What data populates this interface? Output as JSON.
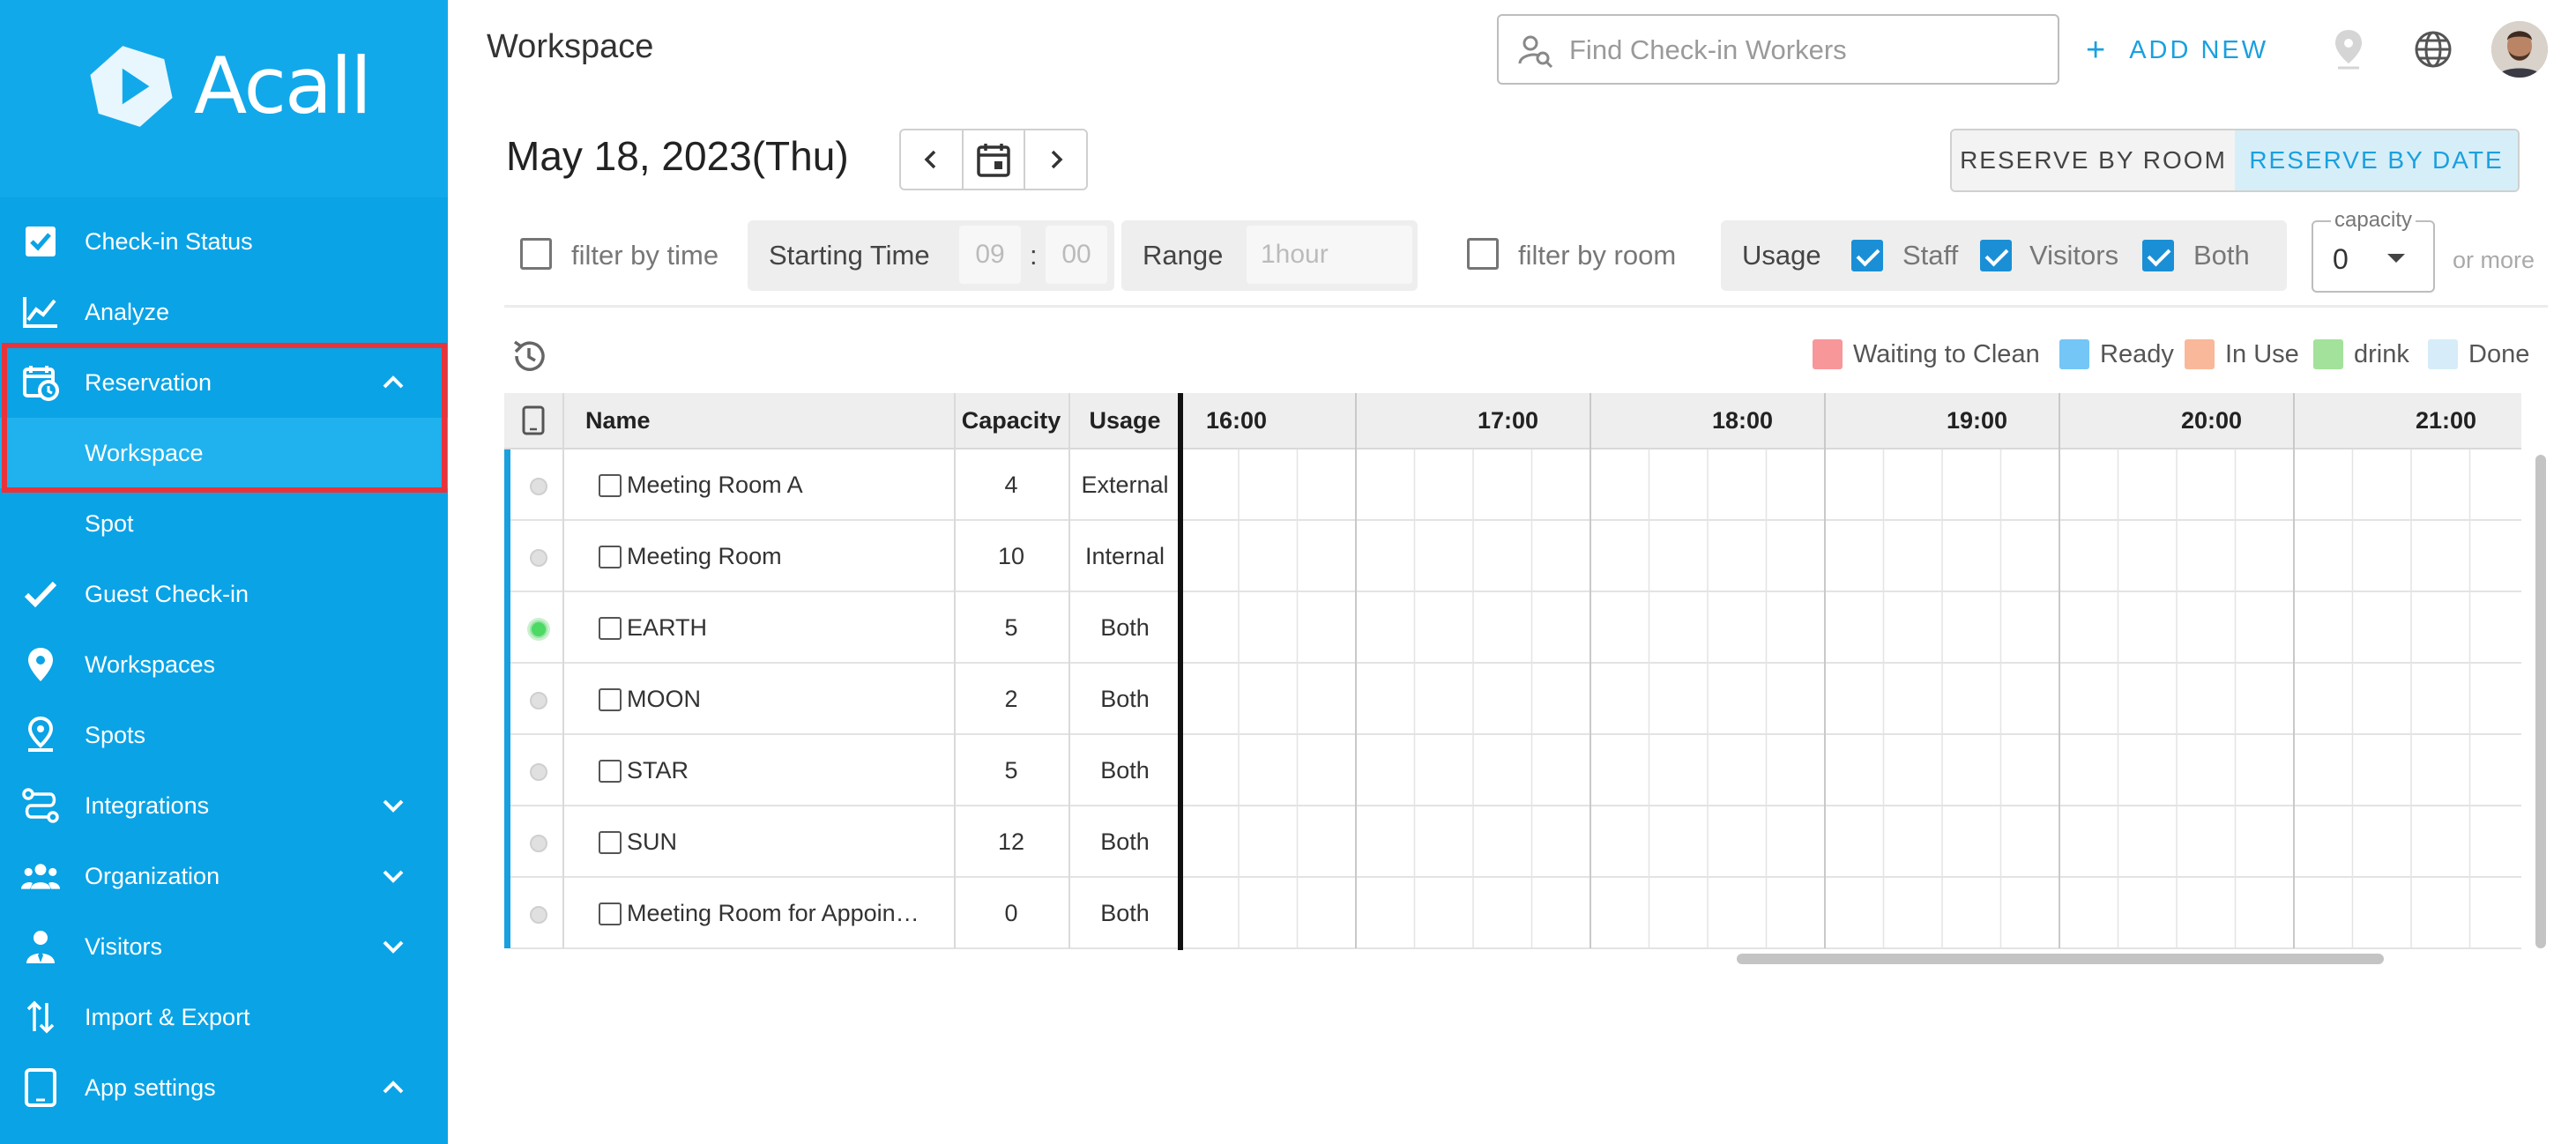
{
  "app": {
    "name": "Acall"
  },
  "sidebar": {
    "items": [
      {
        "label": "Check-in Status",
        "icon": "checkbox-icon"
      },
      {
        "label": "Analyze",
        "icon": "chart-line-icon"
      },
      {
        "label": "Reservation",
        "icon": "calendar-clock-icon",
        "expanded": true
      },
      {
        "label": "Workspace",
        "sub": true,
        "active": true
      },
      {
        "label": "Spot",
        "sub": true
      },
      {
        "label": "Guest Check-in",
        "icon": "check-icon"
      },
      {
        "label": "Workspaces",
        "icon": "map-pin-icon"
      },
      {
        "label": "Spots",
        "icon": "location-pin-icon"
      },
      {
        "label": "Integrations",
        "icon": "integrations-icon",
        "expanded": false
      },
      {
        "label": "Organization",
        "icon": "people-icon",
        "expanded": false
      },
      {
        "label": "Visitors",
        "icon": "visitor-icon",
        "expanded": false
      },
      {
        "label": "Import & Export",
        "icon": "import-export-icon"
      },
      {
        "label": "App settings",
        "icon": "tablet-icon",
        "expanded": true
      }
    ]
  },
  "header": {
    "title": "Workspace",
    "search_placeholder": "Find Check-in Workers",
    "add_new": "ADD NEW"
  },
  "date_bar": {
    "date": "May 18, 2023(Thu)",
    "reserve_by_room": "RESERVE BY ROOM",
    "reserve_by_date": "RESERVE BY DATE",
    "active_mode": "reserve_by_date"
  },
  "filters": {
    "filter_by_time": "filter by time",
    "starting_time_label": "Starting Time",
    "hour": "09",
    "colon": ":",
    "minute": "00",
    "range_label": "Range",
    "range_value": "1hour",
    "filter_by_room": "filter by room",
    "usage_label": "Usage",
    "staff": "Staff",
    "visitors": "Visitors",
    "both": "Both",
    "capacity_label": "capacity",
    "capacity_value": "0",
    "or_more": "or more"
  },
  "legend": [
    {
      "label": "Waiting to Clean",
      "color": "#f7979a"
    },
    {
      "label": "Ready",
      "color": "#74c6f7"
    },
    {
      "label": "In Use",
      "color": "#f9b899"
    },
    {
      "label": "drink",
      "color": "#a3e29a"
    },
    {
      "label": "Done",
      "color": "#d6ecf8"
    }
  ],
  "table": {
    "headers": {
      "name": "Name",
      "capacity": "Capacity",
      "usage": "Usage"
    },
    "times": [
      "16:00",
      "17:00",
      "18:00",
      "19:00",
      "20:00",
      "21:00"
    ],
    "rows": [
      {
        "name": "Meeting Room A",
        "capacity": "4",
        "usage": "External",
        "status": "gray"
      },
      {
        "name": "Meeting Room",
        "capacity": "10",
        "usage": "Internal",
        "status": "gray"
      },
      {
        "name": "EARTH",
        "capacity": "5",
        "usage": "Both",
        "status": "green"
      },
      {
        "name": "MOON",
        "capacity": "2",
        "usage": "Both",
        "status": "gray"
      },
      {
        "name": "STAR",
        "capacity": "5",
        "usage": "Both",
        "status": "gray"
      },
      {
        "name": "SUN",
        "capacity": "12",
        "usage": "Both",
        "status": "gray"
      },
      {
        "name": "Meeting Room for Appoin…",
        "capacity": "0",
        "usage": "Both",
        "status": "gray"
      }
    ]
  }
}
